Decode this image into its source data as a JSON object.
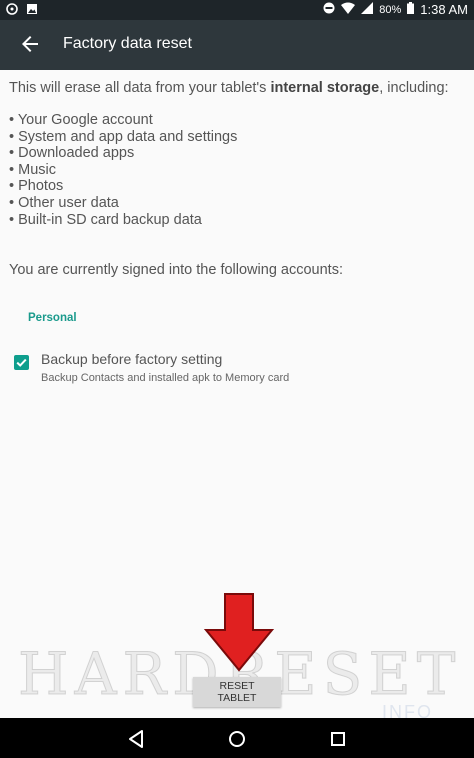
{
  "status_bar": {
    "battery": "80%",
    "time": "1:38 AM",
    "icons": [
      "notification-icon",
      "image-notification-icon",
      "do-not-disturb-icon",
      "wifi-icon",
      "signal-icon",
      "battery-icon"
    ]
  },
  "app_bar": {
    "title": "Factory data reset",
    "back_icon": "arrow-back-icon"
  },
  "content": {
    "intro_prefix": "This will erase all data from your tablet's ",
    "intro_bold": "internal storage",
    "intro_suffix": ", including:",
    "items": [
      "Your Google account",
      "System and app data and settings",
      "Downloaded apps",
      "Music",
      "Photos",
      "Other user data",
      "Built-in SD card backup data"
    ],
    "signed_in_text": "You are currently signed into the following accounts:",
    "section_header": "Personal",
    "backup": {
      "title": "Backup before factory setting",
      "subtitle": "Backup Contacts and installed apk to Memory card",
      "checked": true
    },
    "reset_button_label": "RESET TABLET"
  },
  "watermark": {
    "text": "HARDRESET",
    "sub": "INFO"
  },
  "colors": {
    "status_bar": "#1e2529",
    "app_bar": "#2e373c",
    "accent": "#0e9e8d",
    "arrow": "#e02020",
    "background": "#fafafa"
  }
}
